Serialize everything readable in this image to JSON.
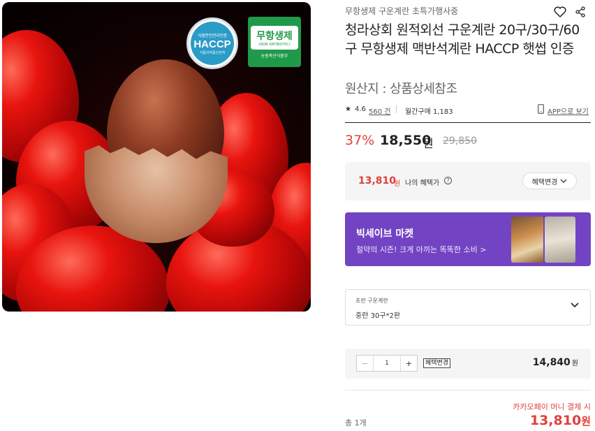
{
  "product_image": {
    "badge_haccp": {
      "top": "식품안전관리인증",
      "main": "HACCP",
      "bottom": "식품의약품안전처"
    },
    "badge_nonab": {
      "main": "무항생제",
      "sub": "(NON ANTIBIOTIC)",
      "foot": "농림축산식품부"
    }
  },
  "header": {
    "store_name": "무항생제 구운계란 초특가행사중",
    "wishlist_icon": "heart-icon",
    "share_icon": "share-icon"
  },
  "title": "청라상회 원적외선 구운계란 20구/30구/60구 무항생제 맥반석계란 HACCP 햇썹 인증",
  "origin": "원산지 : 상품상세참조",
  "meta": {
    "rating_icon": "star-icon",
    "rating": "4.6",
    "review_count": "560 건",
    "monthly_purchase": "월간구매 1,183",
    "app_icon": "phone-icon",
    "app_link": "APP으로 보기"
  },
  "price": {
    "discount": "37%",
    "sale_price": "18,550",
    "unit": "원",
    "original_price": "29,850"
  },
  "benefit": {
    "price": "13,810",
    "unit": "원",
    "label": "나의 혜택가",
    "help_icon": "?",
    "button_label": "혜택변경"
  },
  "banner": {
    "title": "빅세이브 마켓",
    "subtitle": "절약의 시즌! 크게 아끼는 똑똑한 소비 >"
  },
  "option": {
    "label": "초란 구운계란",
    "value": "중란 30구*2판"
  },
  "quantity": {
    "minus": "−",
    "value": "1",
    "plus": "+",
    "benefit_tag": "혜택변경",
    "line_price": "14,840",
    "unit": "원"
  },
  "total": {
    "count": "총 1개",
    "kakao_note": "카카오페이 머니 결제 시",
    "price": "13,810",
    "unit": "원"
  },
  "colors": {
    "accent_red": "#e0403c",
    "banner_purple": "#7244c3",
    "haccp_blue": "#2b9bc7",
    "nonab_green": "#1f9a4a"
  }
}
